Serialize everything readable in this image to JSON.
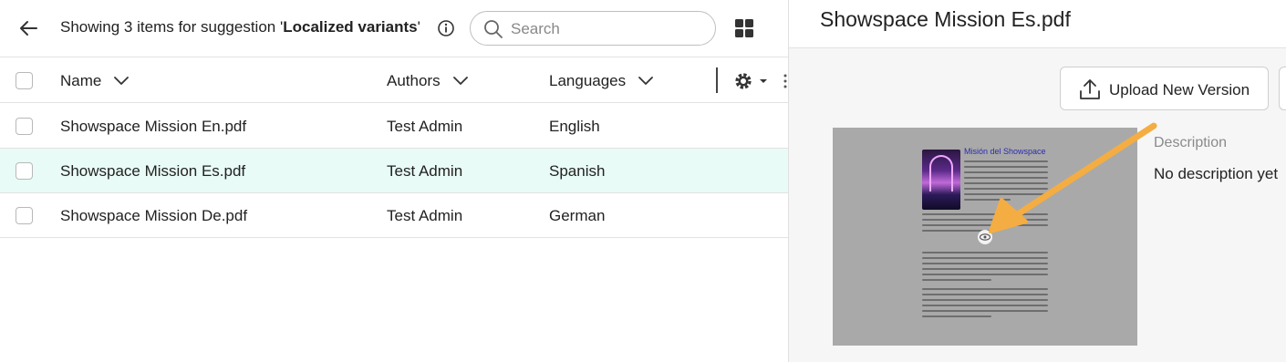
{
  "header": {
    "showing_prefix": "Showing 3 items for suggestion '",
    "suggestion": "Localized variants",
    "showing_suffix": "'",
    "search_placeholder": "Search"
  },
  "table": {
    "columns": [
      "Name",
      "Authors",
      "Languages"
    ],
    "rows": [
      {
        "name": "Showspace Mission En.pdf",
        "author": "Test Admin",
        "language": "English",
        "selected": false
      },
      {
        "name": "Showspace Mission Es.pdf",
        "author": "Test Admin",
        "language": "Spanish",
        "selected": true
      },
      {
        "name": "Showspace Mission De.pdf",
        "author": "Test Admin",
        "language": "German",
        "selected": false
      }
    ]
  },
  "detail": {
    "title": "Showspace Mission Es.pdf",
    "upload_label": "Upload New Version",
    "preview_doc_title": "Misión del Showspace",
    "description_label": "Description",
    "description_value": "No description yet"
  },
  "colors": {
    "selected_row": "#e8fbf6",
    "annotation_arrow": "#f4ad42",
    "doc_title": "#2b2bb0"
  },
  "icons": [
    "back-arrow-icon",
    "info-icon",
    "search-icon",
    "grid-view-icon",
    "chevron-down-icon",
    "gear-icon",
    "more-dots-icon",
    "upload-icon",
    "eye-icon"
  ]
}
